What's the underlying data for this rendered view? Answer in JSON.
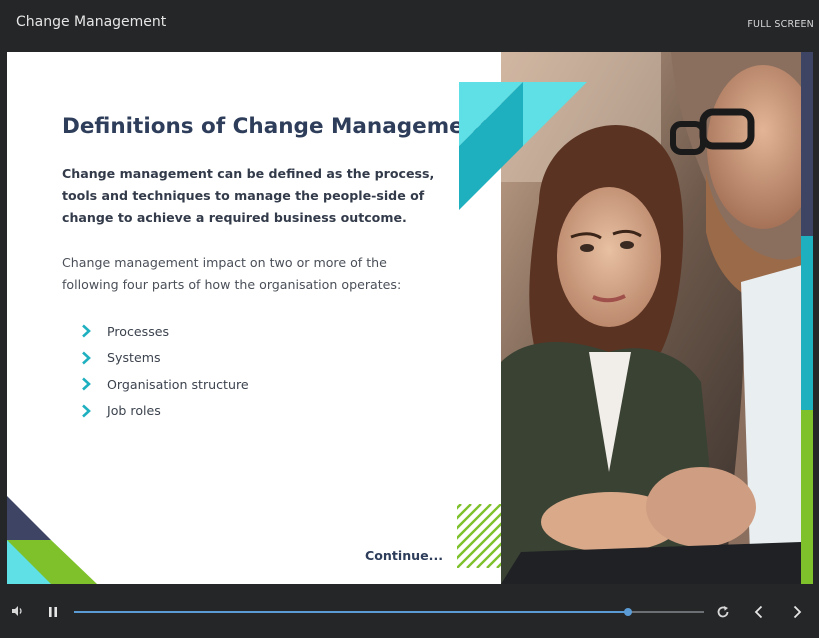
{
  "app": {
    "title": "Change Management",
    "fullscreen_label": "FULL SCREEN"
  },
  "slide": {
    "title": "Definitions of Change Management",
    "lead": "Change management can be defined as the process, tools and techniques to manage the people-side of change to achieve a required business outcome.",
    "body": "Change management impact on  two or more of the following four parts of how the organisation operates:",
    "bullets": [
      "Processes",
      "Systems",
      "Organisation structure",
      "Job roles"
    ],
    "continue_label": "Continue...",
    "photo_alt": "Two people looking at a laptop"
  },
  "player": {
    "progress": 0.88
  },
  "colors": {
    "title": "#2d3d5a",
    "teal": "#1fb0c0",
    "teal_light": "#5ee0e6",
    "green": "#7ec12b",
    "navy": "#3e4463",
    "progress": "#5b9bd5"
  },
  "icons": [
    "chevron-right-icon",
    "volume-icon",
    "pause-icon",
    "replay-icon",
    "previous-icon",
    "next-icon"
  ]
}
